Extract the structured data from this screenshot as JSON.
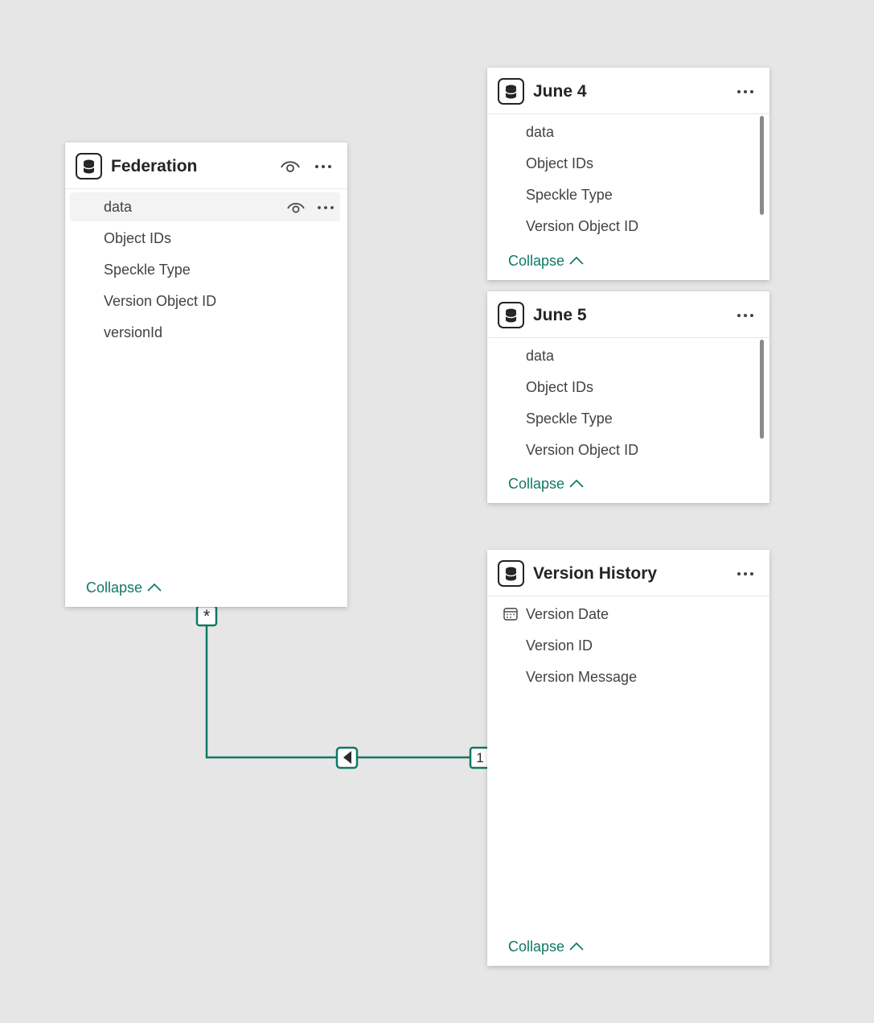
{
  "tables": {
    "federation": {
      "title": "Federation",
      "fields": [
        "data",
        "Object IDs",
        "Speckle Type",
        "Version Object ID",
        "versionId"
      ],
      "collapse_label": "Collapse"
    },
    "june4": {
      "title": "June 4",
      "fields": [
        "data",
        "Object IDs",
        "Speckle Type",
        "Version Object ID"
      ],
      "collapse_label": "Collapse"
    },
    "june5": {
      "title": "June 5",
      "fields": [
        "data",
        "Object IDs",
        "Speckle Type",
        "Version Object ID"
      ],
      "collapse_label": "Collapse"
    },
    "version_history": {
      "title": "Version History",
      "fields": [
        "Version Date",
        "Version ID",
        "Version Message"
      ],
      "collapse_label": "Collapse"
    }
  },
  "relationship": {
    "from_cardinality": "*",
    "to_cardinality": "1",
    "color": "#117865"
  },
  "colors": {
    "canvas": "#e6e6e6",
    "accent": "#117865",
    "text": "#242424"
  }
}
